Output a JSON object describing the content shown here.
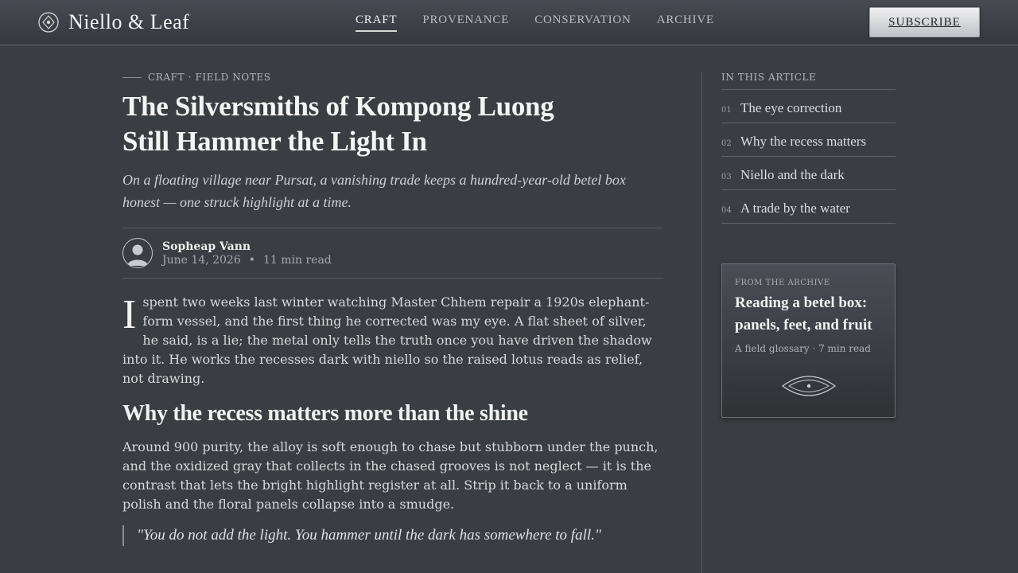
{
  "header": {
    "brand": "Niello & Leaf",
    "brand_icon": "medallion-icon",
    "nav": [
      "CRAFT",
      "PROVENANCE",
      "CONSERVATION",
      "ARCHIVE"
    ],
    "nav_active": "CRAFT",
    "subscribe_label": "SUBSCRIBE"
  },
  "article": {
    "eyebrow": "CRAFT · FIELD NOTES",
    "title": "The Silversmiths of Kompong Luong Still Hammer the Light In",
    "dek": "On a floating village near Pursat, a vanishing trade keeps a hundred-year-old betel box honest — one struck highlight at a time.",
    "author": "Sopheap Vann",
    "date": "June 14, 2026",
    "read_time": "11 min read",
    "dropcap": "I",
    "lead": "spent two weeks last winter watching Master Chhem repair a 1920s elephant-form vessel, and the first thing he corrected was my eye. A flat sheet of silver, he said, is a lie; the metal only tells the truth once you have driven the shadow into it. He works the recesses dark with niello so the raised lotus reads as relief, not drawing.",
    "subhead": "Why the recess matters more than the shine",
    "body": "Around 900 purity, the alloy is soft enough to chase but stubborn under the punch, and the oxidized gray that collects in the chased grooves is not neglect — it is the contrast that lets the bright highlight register at all. Strip it back to a uniform polish and the floral panels collapse into a smudge.",
    "quote": "\"You do not add the light. You hammer until the dark has somewhere to fall.\""
  },
  "sidebar": {
    "toc_heading": "IN THIS ARTICLE",
    "toc": [
      {
        "num": "01",
        "label": "The eye correction"
      },
      {
        "num": "02",
        "label": "Why the recess matters"
      },
      {
        "num": "03",
        "label": "Niello and the dark"
      },
      {
        "num": "04",
        "label": "A trade by the water"
      }
    ],
    "archive": {
      "kicker": "FROM THE ARCHIVE",
      "title": "Reading a betel box: panels, feet, and fruit",
      "meta": "A field glossary · 7 min read",
      "emblem": "eye-ornament-icon"
    }
  },
  "colors": {
    "background": "#3a3d41",
    "header_top": "#474a52",
    "button": "#e6e7ea",
    "text": "#e6e6e6"
  }
}
